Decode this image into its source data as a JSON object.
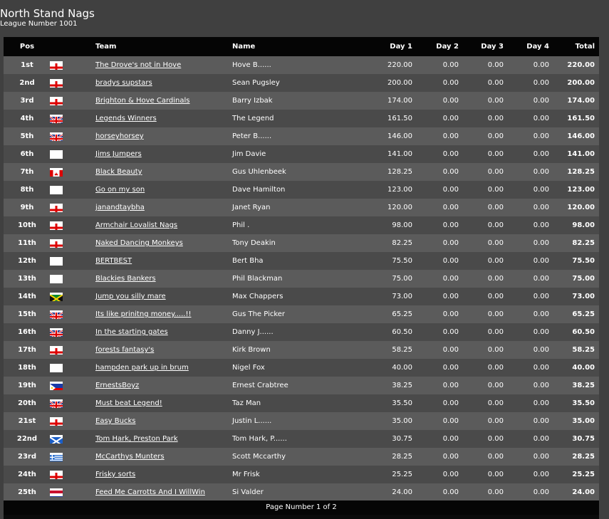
{
  "title": "North Stand Nags",
  "subtitle": "League Number 1001",
  "columns": {
    "pos": "Pos",
    "team": "Team",
    "name": "Name",
    "day1": "Day 1",
    "day2": "Day 2",
    "day3": "Day 3",
    "day4": "Day 4",
    "total": "Total"
  },
  "rows": [
    {
      "pos": "1st",
      "flag": "england",
      "team": "The Drove's not in Hove",
      "name": "Hove B......",
      "day1": "220.00",
      "day2": "0.00",
      "day3": "0.00",
      "day4": "0.00",
      "total": "220.00"
    },
    {
      "pos": "2nd",
      "flag": "england",
      "team": "bradys supstars",
      "name": "Sean Pugsley",
      "day1": "200.00",
      "day2": "0.00",
      "day3": "0.00",
      "day4": "0.00",
      "total": "200.00"
    },
    {
      "pos": "3rd",
      "flag": "england",
      "team": "Brighton & Hove Cardinals",
      "name": "Barry Izbak",
      "day1": "174.00",
      "day2": "0.00",
      "day3": "0.00",
      "day4": "0.00",
      "total": "174.00"
    },
    {
      "pos": "4th",
      "flag": "uk",
      "team": "Legends Winners",
      "name": "The Legend",
      "day1": "161.50",
      "day2": "0.00",
      "day3": "0.00",
      "day4": "0.00",
      "total": "161.50"
    },
    {
      "pos": "5th",
      "flag": "uk",
      "team": "horseyhorsey",
      "name": "Peter B......",
      "day1": "146.00",
      "day2": "0.00",
      "day3": "0.00",
      "day4": "0.00",
      "total": "146.00"
    },
    {
      "pos": "6th",
      "flag": "blank",
      "team": "Jims Jumpers",
      "name": "Jim Davie",
      "day1": "141.00",
      "day2": "0.00",
      "day3": "0.00",
      "day4": "0.00",
      "total": "141.00"
    },
    {
      "pos": "7th",
      "flag": "canada",
      "team": "Black Beauty",
      "name": "Gus Uhlenbeek",
      "day1": "128.25",
      "day2": "0.00",
      "day3": "0.00",
      "day4": "0.00",
      "total": "128.25"
    },
    {
      "pos": "8th",
      "flag": "blank",
      "team": "Go on my son",
      "name": "Dave Hamilton",
      "day1": "123.00",
      "day2": "0.00",
      "day3": "0.00",
      "day4": "0.00",
      "total": "123.00"
    },
    {
      "pos": "9th",
      "flag": "england",
      "team": "janandtaybha",
      "name": "Janet Ryan",
      "day1": "120.00",
      "day2": "0.00",
      "day3": "0.00",
      "day4": "0.00",
      "total": "120.00"
    },
    {
      "pos": "10th",
      "flag": "england",
      "team": "Armchair Lovalist Nags",
      "name": "Phil .",
      "day1": "98.00",
      "day2": "0.00",
      "day3": "0.00",
      "day4": "0.00",
      "total": "98.00"
    },
    {
      "pos": "11th",
      "flag": "england",
      "team": "Naked Dancing Monkeys",
      "name": "Tony Deakin",
      "day1": "82.25",
      "day2": "0.00",
      "day3": "0.00",
      "day4": "0.00",
      "total": "82.25"
    },
    {
      "pos": "12th",
      "flag": "blank",
      "team": "BERTBEST",
      "name": "Bert Bha",
      "day1": "75.50",
      "day2": "0.00",
      "day3": "0.00",
      "day4": "0.00",
      "total": "75.50"
    },
    {
      "pos": "13th",
      "flag": "blank",
      "team": "Blackies Bankers",
      "name": "Phil Blackman",
      "day1": "75.00",
      "day2": "0.00",
      "day3": "0.00",
      "day4": "0.00",
      "total": "75.00"
    },
    {
      "pos": "14th",
      "flag": "jamaica",
      "team": "Jump you silly mare",
      "name": "Max Chappers",
      "day1": "73.00",
      "day2": "0.00",
      "day3": "0.00",
      "day4": "0.00",
      "total": "73.00"
    },
    {
      "pos": "15th",
      "flag": "uk",
      "team": "Its like prinitng money.....!!",
      "name": "Gus The Picker",
      "day1": "65.25",
      "day2": "0.00",
      "day3": "0.00",
      "day4": "0.00",
      "total": "65.25"
    },
    {
      "pos": "16th",
      "flag": "uk",
      "team": "In the starting gates",
      "name": "Danny J......",
      "day1": "60.50",
      "day2": "0.00",
      "day3": "0.00",
      "day4": "0.00",
      "total": "60.50"
    },
    {
      "pos": "17th",
      "flag": "england",
      "team": "forests fantasy's",
      "name": "Kirk Brown",
      "day1": "58.25",
      "day2": "0.00",
      "day3": "0.00",
      "day4": "0.00",
      "total": "58.25"
    },
    {
      "pos": "18th",
      "flag": "blank",
      "team": "hampden park up in brum",
      "name": "Nigel Fox",
      "day1": "40.00",
      "day2": "0.00",
      "day3": "0.00",
      "day4": "0.00",
      "total": "40.00"
    },
    {
      "pos": "19th",
      "flag": "philippines",
      "team": "ErnestsBoyz",
      "name": "Ernest Crabtree",
      "day1": "38.25",
      "day2": "0.00",
      "day3": "0.00",
      "day4": "0.00",
      "total": "38.25"
    },
    {
      "pos": "20th",
      "flag": "uk",
      "team": "Must beat Legend!",
      "name": "Taz Man",
      "day1": "35.50",
      "day2": "0.00",
      "day3": "0.00",
      "day4": "0.00",
      "total": "35.50"
    },
    {
      "pos": "21st",
      "flag": "england",
      "team": "Easy Bucks",
      "name": "Justin L......",
      "day1": "35.00",
      "day2": "0.00",
      "day3": "0.00",
      "day4": "0.00",
      "total": "35.00"
    },
    {
      "pos": "22nd",
      "flag": "scotland",
      "team": "Tom Hark, Preston Park",
      "name": "Tom Hark, P......",
      "day1": "30.75",
      "day2": "0.00",
      "day3": "0.00",
      "day4": "0.00",
      "total": "30.75"
    },
    {
      "pos": "23rd",
      "flag": "greece",
      "team": "McCarthys Munters",
      "name": "Scott Mccarthy",
      "day1": "28.25",
      "day2": "0.00",
      "day3": "0.00",
      "day4": "0.00",
      "total": "28.25"
    },
    {
      "pos": "24th",
      "flag": "england",
      "team": "Frisky sorts",
      "name": "Mr Frisk",
      "day1": "25.25",
      "day2": "0.00",
      "day3": "0.00",
      "day4": "0.00",
      "total": "25.25"
    },
    {
      "pos": "25th",
      "flag": "netherlands",
      "team": "Feed Me Carrotts And I WillWin",
      "name": "Si Valder",
      "day1": "24.00",
      "day2": "0.00",
      "day3": "0.00",
      "day4": "0.00",
      "total": "24.00"
    }
  ],
  "footer": "Page Number 1 of 2"
}
